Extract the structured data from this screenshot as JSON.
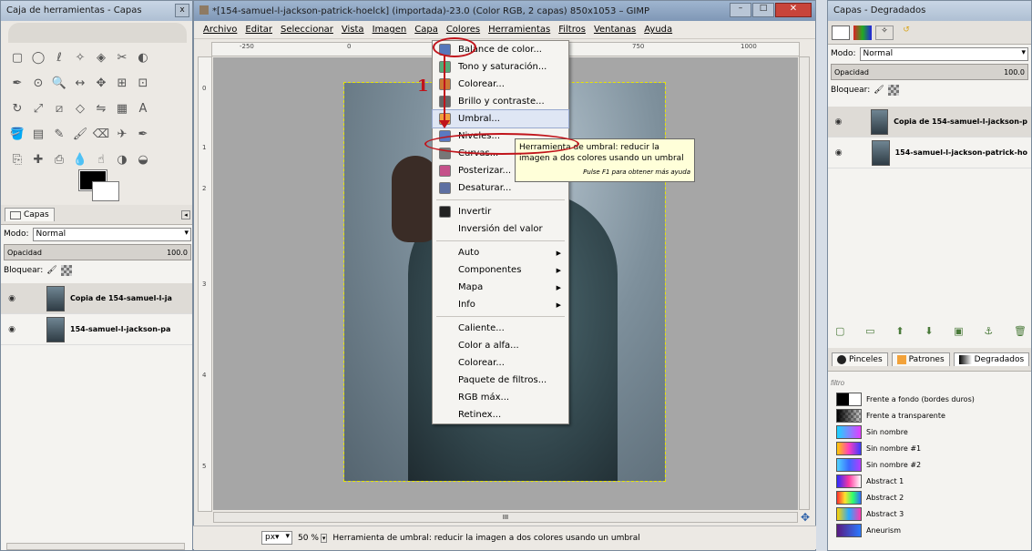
{
  "toolbox": {
    "title": "Caja de herramientas - Capas",
    "close": "x",
    "tools": [
      "rect-select-icon",
      "ellipse-select-icon",
      "free-select-icon",
      "fuzzy-select-icon",
      "color-select-icon",
      "scissors-icon",
      "foreground-select-icon",
      "paths-icon",
      "color-picker-icon",
      "zoom-icon",
      "measure-icon",
      "move-icon",
      "align-icon",
      "crop-icon",
      "rotate-icon",
      "scale-icon",
      "shear-icon",
      "perspective-icon",
      "flip-icon",
      "cage-icon",
      "text-icon",
      "bucket-fill-icon",
      "blend-icon",
      "pencil-icon",
      "paintbrush-icon",
      "eraser-icon",
      "airbrush-icon",
      "ink-icon",
      "clone-icon",
      "heal-icon",
      "perspective-clone-icon",
      "blur-icon",
      "smudge-icon",
      "dodge-icon",
      "burn-icon"
    ],
    "layers_tab": "Capas",
    "mode_label": "Modo:",
    "mode_value": "Normal",
    "opacity_label": "Opacidad",
    "opacity_value": "100.0",
    "lock_label": "Bloquear:",
    "layers": [
      {
        "name": "Copia de 154-samuel-l-ja"
      },
      {
        "name": "154-samuel-l-jackson-pa"
      }
    ]
  },
  "gimp": {
    "title": "*[154-samuel-l-jackson-patrick-hoelck] (importada)-23.0 (Color RGB, 2 capas) 850x1053 – GIMP",
    "menubar": [
      "Archivo",
      "Editar",
      "Seleccionar",
      "Vista",
      "Imagen",
      "Capa",
      "Colores",
      "Herramientas",
      "Filtros",
      "Ventanas",
      "Ayuda"
    ],
    "ruler_ticks": [
      "-250",
      "0",
      "750",
      "1000"
    ],
    "vruler_ticks": [
      "0",
      "1",
      "2",
      "3",
      "4",
      "5",
      "6"
    ],
    "scroll_label": "III",
    "status": {
      "unit": "px▾",
      "zoom": "50 %",
      "message": "Herramienta de umbral: reducir la imagen a dos colores usando un umbral"
    }
  },
  "colors_menu": {
    "items": [
      {
        "label": "Balance de color...",
        "icon": "color-balance-icon"
      },
      {
        "label": "Tono y saturación...",
        "icon": "hue-saturation-icon"
      },
      {
        "label": "Colorear...",
        "icon": "colorize-icon"
      },
      {
        "label": "Brillo y contraste...",
        "icon": "brightness-contrast-icon"
      },
      {
        "label": "Umbral...",
        "icon": "threshold-icon"
      },
      {
        "label": "Niveles...",
        "icon": "levels-icon"
      },
      {
        "label": "Curvas...",
        "icon": "curves-icon"
      },
      {
        "label": "Posterizar...",
        "icon": "posterize-icon"
      },
      {
        "label": "Desaturar...",
        "icon": "desaturate-icon"
      },
      {
        "label": "Invertir",
        "icon": "invert-icon"
      },
      {
        "label": "Inversión del valor"
      },
      {
        "label": "Auto",
        "submenu": true
      },
      {
        "label": "Componentes",
        "submenu": true
      },
      {
        "label": "Mapa",
        "submenu": true
      },
      {
        "label": "Info",
        "submenu": true
      },
      {
        "label": "Caliente..."
      },
      {
        "label": "Color a alfa..."
      },
      {
        "label": "Colorear..."
      },
      {
        "label": "Paquete de filtros..."
      },
      {
        "label": "RGB máx..."
      },
      {
        "label": "Retinex..."
      }
    ],
    "tooltip_text": "Herramienta de umbral: reducir la imagen a dos colores usando un umbral",
    "tooltip_hint": "Pulse F1 para obtener más ayuda"
  },
  "annotation": {
    "number": "1",
    "color": "#c0141b"
  },
  "right_panel": {
    "title": "Capas - Degradados",
    "mode_label": "Modo:",
    "mode_value": "Normal",
    "opacity_label": "Opacidad",
    "opacity_value": "100.0",
    "lock_label": "Bloquear:",
    "layers": [
      {
        "name": "Copia de 154-samuel-l-jackson-p"
      },
      {
        "name": "154-samuel-l-jackson-patrick-ho"
      }
    ],
    "tabs": [
      "Pinceles",
      "Patrones",
      "Degradados"
    ],
    "filter_placeholder": "filtro",
    "gradients": [
      {
        "name": "Frente a fondo (bordes duros)"
      },
      {
        "name": "Frente a transparente"
      },
      {
        "name": "Sin nombre"
      },
      {
        "name": "Sin nombre #1"
      },
      {
        "name": "Sin nombre #2"
      },
      {
        "name": "Abstract 1"
      },
      {
        "name": "Abstract 2"
      },
      {
        "name": "Abstract 3"
      },
      {
        "name": "Aneurism"
      }
    ]
  }
}
